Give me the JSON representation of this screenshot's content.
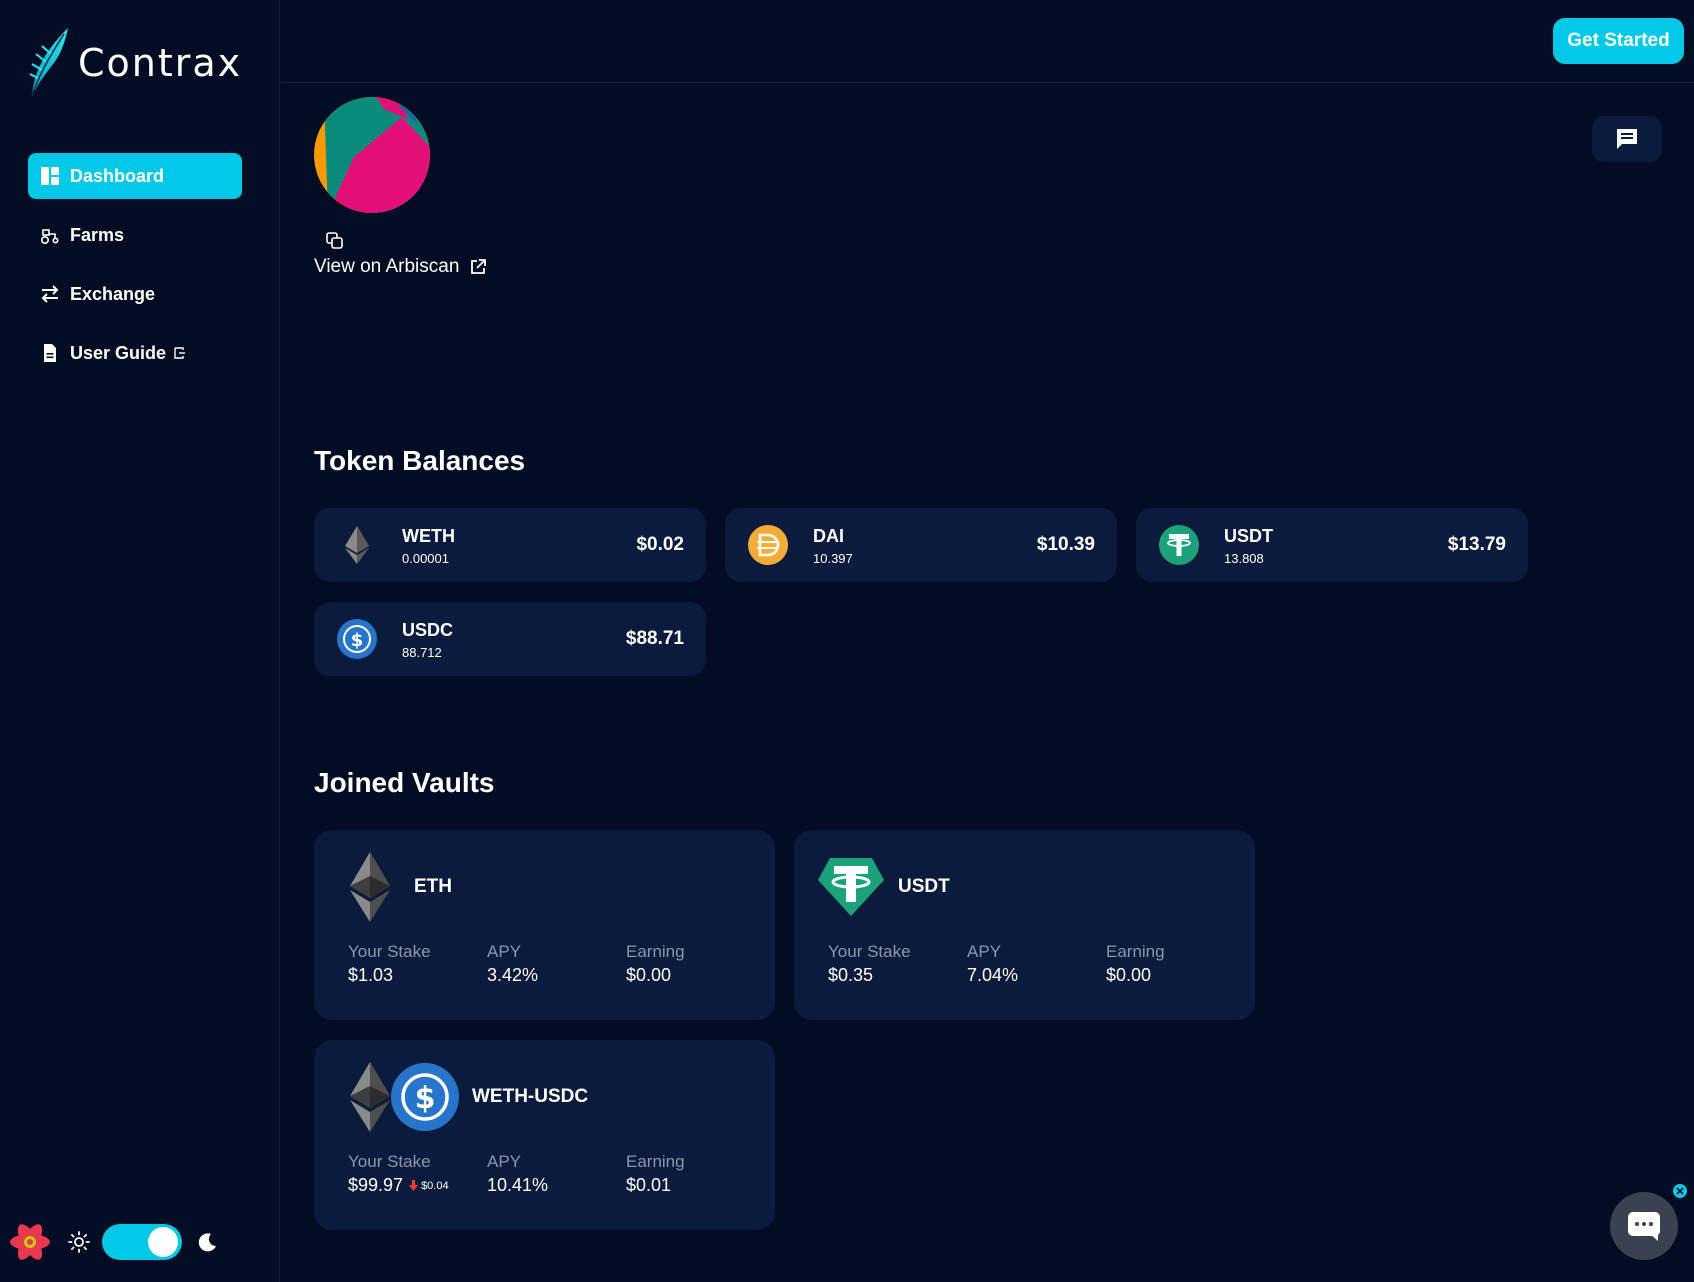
{
  "app": {
    "name": "Contrax"
  },
  "sidebar": {
    "items": [
      {
        "label": "Dashboard",
        "icon": "dashboard-icon",
        "active": true
      },
      {
        "label": "Farms",
        "icon": "tractor-icon",
        "active": false
      },
      {
        "label": "Exchange",
        "icon": "arrows-exchange-icon",
        "active": false
      },
      {
        "label": "User Guide",
        "icon": "document-icon",
        "active": false
      }
    ]
  },
  "header": {
    "get_started_label": "Get Started"
  },
  "profile": {
    "arbiscan_label": "View on Arbiscan"
  },
  "token_balances": {
    "title": "Token Balances",
    "tokens": [
      {
        "symbol": "WETH",
        "amount": "0.00001",
        "usd": "$0.02",
        "icon": "eth-icon"
      },
      {
        "symbol": "DAI",
        "amount": "10.397",
        "usd": "$10.39",
        "icon": "dai-icon"
      },
      {
        "symbol": "USDT",
        "amount": "13.808",
        "usd": "$13.79",
        "icon": "usdt-icon"
      },
      {
        "symbol": "USDC",
        "amount": "88.712",
        "usd": "$88.71",
        "icon": "usdc-icon"
      }
    ]
  },
  "joined_vaults": {
    "title": "Joined Vaults",
    "labels": {
      "stake": "Your Stake",
      "apy": "APY",
      "earning": "Earning"
    },
    "vaults": [
      {
        "name": "ETH",
        "stake": "$1.03",
        "apy": "3.42%",
        "earning": "$0.00",
        "delta": ""
      },
      {
        "name": "USDT",
        "stake": "$0.35",
        "apy": "7.04%",
        "earning": "$0.00",
        "delta": ""
      },
      {
        "name": "WETH-USDC",
        "stake": "$99.97",
        "apy": "10.41%",
        "earning": "$0.01",
        "delta": "$0.04"
      }
    ]
  },
  "colors": {
    "background": "#020c22",
    "card": "#0b1b3d",
    "accent": "#00c8e6",
    "muted_label": "#8c96ab",
    "negative": "#ff3b3b"
  },
  "theme": {
    "dark_mode": true
  }
}
